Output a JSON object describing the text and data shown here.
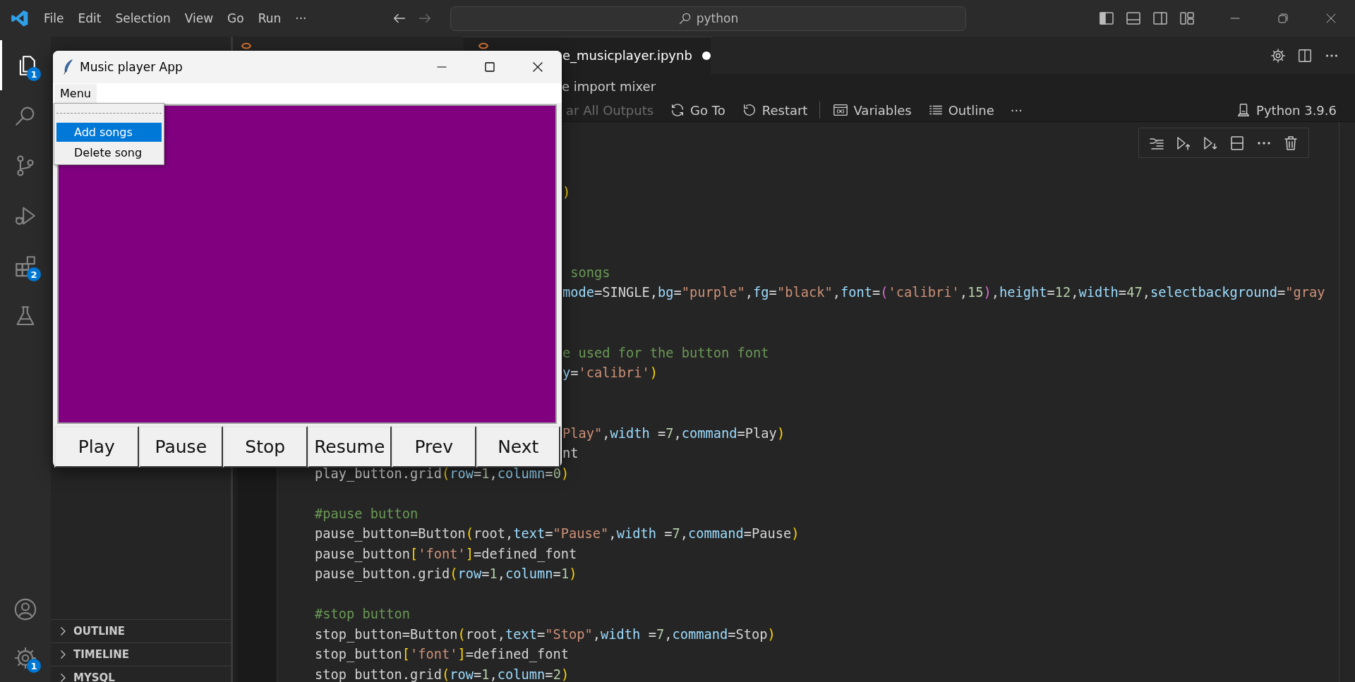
{
  "title_bar": {
    "menu": [
      "File",
      "Edit",
      "Selection",
      "View",
      "Go",
      "Run",
      "···"
    ],
    "search": {
      "value": "python"
    }
  },
  "activity_bar": {
    "items": [
      {
        "kind": "explorer",
        "selected": true,
        "badge": "1"
      },
      {
        "kind": "search",
        "selected": false
      },
      {
        "kind": "source_control",
        "selected": false
      },
      {
        "kind": "run_debug",
        "selected": false
      },
      {
        "kind": "extensions",
        "selected": false,
        "badge": "2"
      },
      {
        "kind": "testing",
        "selected": false
      }
    ],
    "bottom": [
      {
        "kind": "account"
      },
      {
        "kind": "manage",
        "badge": "1"
      }
    ]
  },
  "sidebar": {
    "sections": [
      {
        "label": "OUTLINE",
        "expanded": false
      },
      {
        "label": "TIMELINE",
        "expanded": false
      },
      {
        "label": "MYSQL",
        "expanded": false
      }
    ]
  },
  "editor": {
    "tabs": [
      {
        "selected": false
      },
      {
        "label": "e_musicplayer.ipynb",
        "selected": true,
        "modified": true
      }
    ],
    "breadcrumb": "e import mixer",
    "toolbar": [
      {
        "kind": "text",
        "label": "ar All Outputs",
        "disabled": true
      },
      {
        "kind": "goto",
        "label": "Go To",
        "disabled": false
      },
      {
        "kind": "restart",
        "label": "Restart",
        "disabled": false
      },
      {
        "kind": "separator"
      },
      {
        "kind": "variables",
        "label": "Variables",
        "disabled": false
      },
      {
        "kind": "outline",
        "label": "Outline",
        "disabled": false
      },
      {
        "kind": "text",
        "label": "···",
        "disabled": false
      }
    ],
    "kernel": "Python 3.9.6",
    "cell_toolbar": [
      {
        "kind": "execute_lines"
      },
      {
        "kind": "run_above"
      },
      {
        "kind": "run_below"
      },
      {
        "kind": "split"
      },
      {
        "kind": "more"
      },
      {
        "kind": "delete"
      }
    ],
    "code_lines": [
      {
        "kind": "blank"
      },
      {
        "kind": "blank"
      },
      {
        "kind": "blank"
      },
      {
        "kind": "clipped",
        "tokens": [
          {
            "kind": "bracket",
            "text": ")"
          }
        ]
      },
      {
        "kind": "blank"
      },
      {
        "kind": "blank"
      },
      {
        "kind": "blank"
      },
      {
        "kind": "clipped",
        "tokens": [
          {
            "kind": "comment",
            "text": " songs"
          }
        ]
      },
      {
        "kind": "clipped",
        "tokens": [
          {
            "kind": "param",
            "text": "mode"
          },
          {
            "kind": "plain",
            "text": "=SINGLE,"
          },
          {
            "kind": "param",
            "text": "bg"
          },
          {
            "kind": "plain",
            "text": "="
          },
          {
            "kind": "string",
            "text": "\"purple\""
          },
          {
            "kind": "plain",
            "text": ","
          },
          {
            "kind": "param",
            "text": "fg"
          },
          {
            "kind": "plain",
            "text": "="
          },
          {
            "kind": "string",
            "text": "\"black\""
          },
          {
            "kind": "plain",
            "text": ","
          },
          {
            "kind": "param",
            "text": "font"
          },
          {
            "kind": "plain",
            "text": "="
          },
          {
            "kind": "bracket2",
            "text": "("
          },
          {
            "kind": "string",
            "text": "'calibri'"
          },
          {
            "kind": "plain",
            "text": ","
          },
          {
            "kind": "number",
            "text": "15"
          },
          {
            "kind": "bracket2",
            "text": ")"
          },
          {
            "kind": "plain",
            "text": ","
          },
          {
            "kind": "param",
            "text": "height"
          },
          {
            "kind": "plain",
            "text": "="
          },
          {
            "kind": "number",
            "text": "12"
          },
          {
            "kind": "plain",
            "text": ","
          },
          {
            "kind": "param",
            "text": "width"
          },
          {
            "kind": "plain",
            "text": "="
          },
          {
            "kind": "number",
            "text": "47"
          },
          {
            "kind": "plain",
            "text": ","
          },
          {
            "kind": "param",
            "text": "selectbackground"
          },
          {
            "kind": "plain",
            "text": "="
          },
          {
            "kind": "string",
            "text": "\"gray"
          }
        ]
      },
      {
        "kind": "blank"
      },
      {
        "kind": "blank"
      },
      {
        "kind": "clipped",
        "tokens": [
          {
            "kind": "comment",
            "text": "e used for the button font"
          }
        ]
      },
      {
        "kind": "clipped",
        "tokens": [
          {
            "kind": "param",
            "text": "y"
          },
          {
            "kind": "plain",
            "text": "="
          },
          {
            "kind": "string",
            "text": "'calibri'"
          },
          {
            "kind": "bracket",
            "text": ")"
          }
        ]
      },
      {
        "kind": "blank"
      },
      {
        "kind": "blank"
      },
      {
        "kind": "clipped",
        "tokens": [
          {
            "kind": "string",
            "text": "Play\""
          },
          {
            "kind": "plain",
            "text": ","
          },
          {
            "kind": "param",
            "text": "width"
          },
          {
            "kind": "plain",
            "text": " ="
          },
          {
            "kind": "number",
            "text": "7"
          },
          {
            "kind": "plain",
            "text": ","
          },
          {
            "kind": "param",
            "text": "command"
          },
          {
            "kind": "plain",
            "text": "=Play"
          },
          {
            "kind": "bracket",
            "text": ")"
          }
        ]
      },
      {
        "kind": "clipped",
        "tokens": [
          {
            "kind": "plain",
            "text": "nt"
          }
        ]
      },
      {
        "kind": "code",
        "tokens": [
          {
            "kind": "plain",
            "text": "play_button.grid"
          },
          {
            "kind": "bracket",
            "text": "("
          },
          {
            "kind": "param",
            "text": "row"
          },
          {
            "kind": "plain",
            "text": "="
          },
          {
            "kind": "number",
            "text": "1"
          },
          {
            "kind": "plain",
            "text": ","
          },
          {
            "kind": "param",
            "text": "column"
          },
          {
            "kind": "plain",
            "text": "="
          },
          {
            "kind": "number",
            "text": "0"
          },
          {
            "kind": "bracket",
            "text": ")"
          }
        ]
      },
      {
        "kind": "blank"
      },
      {
        "kind": "code",
        "tokens": [
          {
            "kind": "comment",
            "text": "#pause button"
          }
        ]
      },
      {
        "kind": "code",
        "tokens": [
          {
            "kind": "plain",
            "text": "pause_button=Button"
          },
          {
            "kind": "bracket",
            "text": "("
          },
          {
            "kind": "plain",
            "text": "root,"
          },
          {
            "kind": "param",
            "text": "text"
          },
          {
            "kind": "plain",
            "text": "="
          },
          {
            "kind": "string",
            "text": "\"Pause\""
          },
          {
            "kind": "plain",
            "text": ","
          },
          {
            "kind": "param",
            "text": "width"
          },
          {
            "kind": "plain",
            "text": " ="
          },
          {
            "kind": "number",
            "text": "7"
          },
          {
            "kind": "plain",
            "text": ","
          },
          {
            "kind": "param",
            "text": "command"
          },
          {
            "kind": "plain",
            "text": "=Pause"
          },
          {
            "kind": "bracket",
            "text": ")"
          }
        ]
      },
      {
        "kind": "code",
        "tokens": [
          {
            "kind": "plain",
            "text": "pause_button"
          },
          {
            "kind": "bracket",
            "text": "["
          },
          {
            "kind": "string",
            "text": "'font'"
          },
          {
            "kind": "bracket",
            "text": "]"
          },
          {
            "kind": "plain",
            "text": "=defined_font"
          }
        ]
      },
      {
        "kind": "code",
        "tokens": [
          {
            "kind": "plain",
            "text": "pause_button.grid"
          },
          {
            "kind": "bracket",
            "text": "("
          },
          {
            "kind": "param",
            "text": "row"
          },
          {
            "kind": "plain",
            "text": "="
          },
          {
            "kind": "number",
            "text": "1"
          },
          {
            "kind": "plain",
            "text": ","
          },
          {
            "kind": "param",
            "text": "column"
          },
          {
            "kind": "plain",
            "text": "="
          },
          {
            "kind": "number",
            "text": "1"
          },
          {
            "kind": "bracket",
            "text": ")"
          }
        ]
      },
      {
        "kind": "blank"
      },
      {
        "kind": "code",
        "tokens": [
          {
            "kind": "comment",
            "text": "#stop button"
          }
        ]
      },
      {
        "kind": "code",
        "tokens": [
          {
            "kind": "plain",
            "text": "stop_button=Button"
          },
          {
            "kind": "bracket",
            "text": "("
          },
          {
            "kind": "plain",
            "text": "root,"
          },
          {
            "kind": "param",
            "text": "text"
          },
          {
            "kind": "plain",
            "text": "="
          },
          {
            "kind": "string",
            "text": "\"Stop\""
          },
          {
            "kind": "plain",
            "text": ","
          },
          {
            "kind": "param",
            "text": "width"
          },
          {
            "kind": "plain",
            "text": " ="
          },
          {
            "kind": "number",
            "text": "7"
          },
          {
            "kind": "plain",
            "text": ","
          },
          {
            "kind": "param",
            "text": "command"
          },
          {
            "kind": "plain",
            "text": "=Stop"
          },
          {
            "kind": "bracket",
            "text": ")"
          }
        ]
      },
      {
        "kind": "code",
        "tokens": [
          {
            "kind": "plain",
            "text": "stop_button"
          },
          {
            "kind": "bracket",
            "text": "["
          },
          {
            "kind": "string",
            "text": "'font'"
          },
          {
            "kind": "bracket",
            "text": "]"
          },
          {
            "kind": "plain",
            "text": "=defined_font"
          }
        ]
      },
      {
        "kind": "code",
        "tokens": [
          {
            "kind": "plain",
            "text": "stop_button.grid"
          },
          {
            "kind": "bracket",
            "text": "("
          },
          {
            "kind": "param",
            "text": "row"
          },
          {
            "kind": "plain",
            "text": "="
          },
          {
            "kind": "number",
            "text": "1"
          },
          {
            "kind": "plain",
            "text": ","
          },
          {
            "kind": "param",
            "text": "column"
          },
          {
            "kind": "plain",
            "text": "="
          },
          {
            "kind": "number",
            "text": "2"
          },
          {
            "kind": "bracket",
            "text": ")"
          }
        ]
      }
    ]
  },
  "tk_window": {
    "title": "Music player App",
    "menubar": [
      {
        "label": "Menu",
        "selected": true
      }
    ],
    "dropdown": {
      "tearoff": true,
      "items": [
        {
          "label": "Add songs",
          "selected": true
        },
        {
          "label": "Delete song",
          "selected": false
        }
      ]
    },
    "buttons": [
      "Play",
      "Pause",
      "Stop",
      "Resume",
      "Prev",
      "Next"
    ]
  }
}
